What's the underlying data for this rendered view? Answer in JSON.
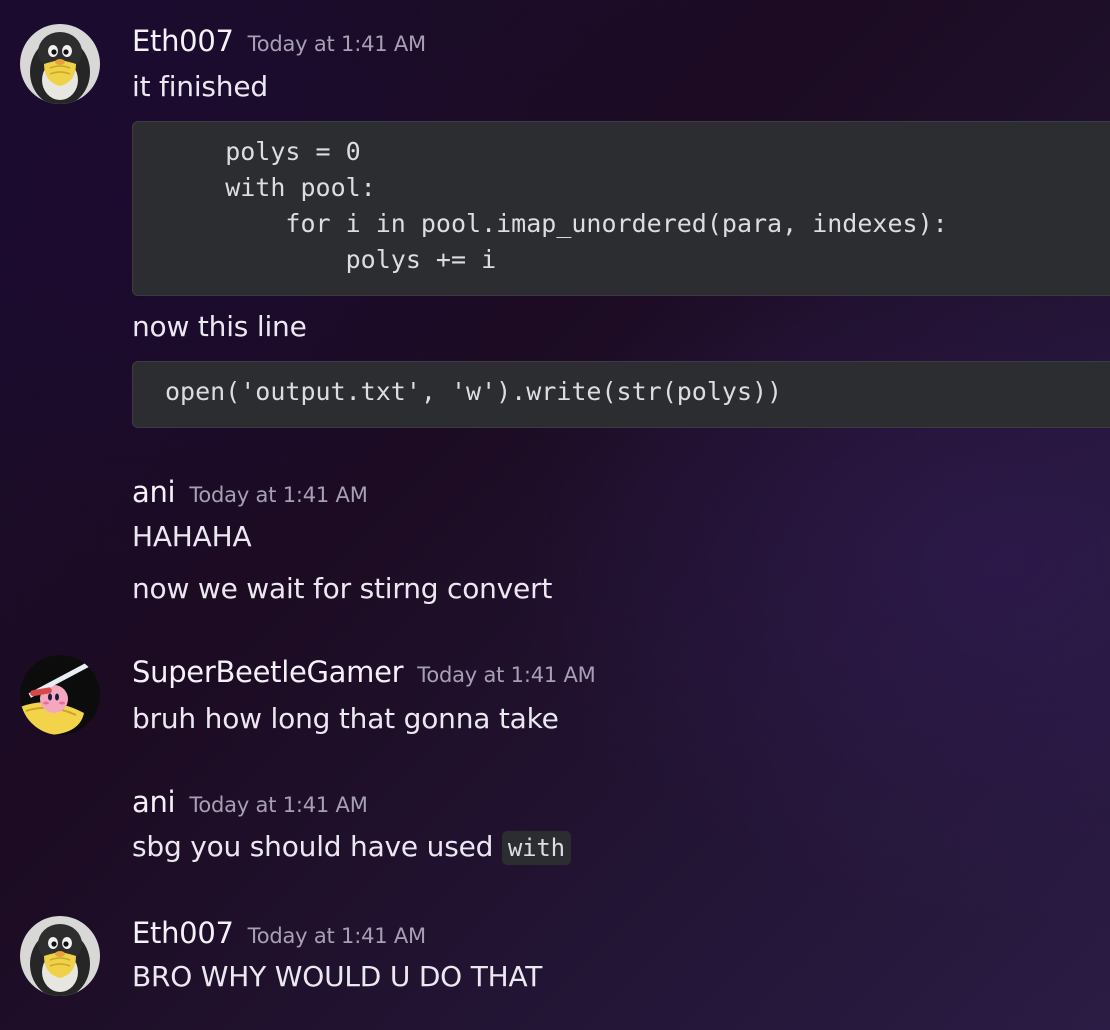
{
  "messages": [
    {
      "username": "Eth007",
      "timestamp": "Today at 1:41 AM",
      "lines": [
        "it finished"
      ],
      "code1": [
        "    polys = 0",
        "    with pool:",
        "        for i in pool.imap_unordered(para, indexes):",
        "            polys += i"
      ],
      "line2": "now this line",
      "code2": [
        "open('output.txt', 'w').write(str(polys))"
      ]
    },
    {
      "username": "ani",
      "timestamp": "Today at 1:41 AM",
      "lines": [
        "HAHAHA",
        "now we wait for stirng convert"
      ]
    },
    {
      "username": "SuperBeetleGamer",
      "timestamp": "Today at 1:41 AM",
      "lines": [
        "bruh how long that gonna take"
      ]
    },
    {
      "username": "ani",
      "timestamp": "Today at 1:41 AM",
      "text_before_code": "sbg you should have used ",
      "inline_code": "with"
    },
    {
      "username": "Eth007",
      "timestamp": "Today at 1:41 AM",
      "lines": [
        "BRO WHY WOULD U DO THAT"
      ]
    }
  ],
  "colors": {
    "background": "#1c0b22",
    "code_background": "#2b2d31",
    "username": "#f4f1f8",
    "timestamp": "#a7a0b4",
    "text": "#ece8f2"
  },
  "icons": {
    "eth007_avatar": "penguin-avatar-icon",
    "superbeetlegamer_avatar": "kirby-avatar-icon"
  }
}
